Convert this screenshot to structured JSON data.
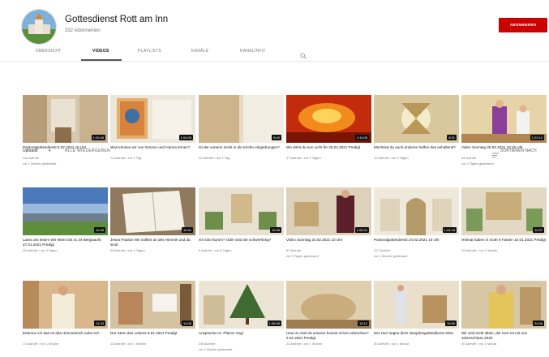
{
  "channel": {
    "name": "Gottesdienst Rott am Inn",
    "subscribers": "332 Abonnenten",
    "subscribe_label": "ABONNIEREN"
  },
  "tabs": [
    {
      "label": "ÜBERSICHT",
      "active": false
    },
    {
      "label": "VIDEOS",
      "active": true
    },
    {
      "label": "PLAYLISTS",
      "active": false
    },
    {
      "label": "KANÄLE",
      "active": false
    },
    {
      "label": "KANALINFO",
      "active": false
    }
  ],
  "toolbar": {
    "uploads_label": "Uploads",
    "play_all_label": "ALLE WIEDERGEBEN",
    "sort_label": "SORTIEREN NACH"
  },
  "videos": [
    {
      "title": "Pastoralgottesdienst 5.02.2021 15 Uhr",
      "meta1": "110 Aufrufe",
      "meta2": "vor 1 Woche gestreamt",
      "duration": "1:02:46"
    },
    {
      "title": "Was können wir von Simeon und Hanna lernen?",
      "meta1": "74 Aufrufe • vor 1 Tag",
      "meta2": "",
      "duration": "1:04:05"
    },
    {
      "title": "Ist der unreine Geist in die Kirche eingedrungen?",
      "meta1": "22 Aufrufe • vor 1 Tag",
      "meta2": "",
      "duration": "8:40"
    },
    {
      "title": "Wo steht du nun Licht für 25.01.2021 Predigt",
      "meta1": "17 Aufrufe • vor 2 Tagen",
      "meta2": "",
      "duration": "1:11:06"
    },
    {
      "title": "Möchtest du auch anderen helfen das anhaltend?",
      "meta1": "22 Aufrufe • vor 2 Tagen",
      "meta2": "",
      "duration": "8:31"
    },
    {
      "title": "Video Sonntag 25.02.2021 10:15 Uhr",
      "meta1": "44 Aufrufe",
      "meta2": "vor 4 Tagen gestreamt",
      "duration": "1:22:14"
    },
    {
      "title": "Lasst uns lesen! Wir leben bis zu 24 Bergwacht 27.01.2021 Predigt",
      "meta1": "26 Aufrufe • vor 3 Tagen",
      "meta2": "",
      "duration": "10:28"
    },
    {
      "title": "Jesus Paulus! Wir sollten an des Himmel und da sind!",
      "meta1": "29 Aufrufe • vor 4 Tagen",
      "meta2": "",
      "duration": "10:41"
    },
    {
      "title": "Ist Gott stumm? Oder sind wir schwerhörig?",
      "meta1": "9 Aufrufe • vor 5 Tagen",
      "meta2": "",
      "duration": "10:28"
    },
    {
      "title": "Video Sonntag 24.02.2021 10 Uhr",
      "meta1": "67 Aufrufe",
      "meta2": "vor 5 Tagen gestreamt",
      "duration": "1:05:22"
    },
    {
      "title": "Pastoralgottesdienst 24.02.2021 10 Uhr",
      "meta1": "227 Aufrufe",
      "meta2": "vor 1 Woche gestreamt",
      "duration": "1:04:18"
    },
    {
      "title": "Heimat haben in Gott! 8 Fasten 10.01.2021 Predigt",
      "meta1": "19 Aufrufe • vor 1 Woche",
      "meta2": "",
      "duration": "12:07"
    },
    {
      "title": "Erkenne ich das es das Himmelreich nahe ist?",
      "meta1": "17 Aufrufe • vor 1 Woche",
      "meta2": "",
      "duration": "11:33"
    },
    {
      "title": "Der Stern des Lebens 6.01.2021 Predigt",
      "meta1": "13 Aufrufe • vor 1 Woche",
      "meta2": "",
      "duration": "14:05"
    },
    {
      "title": "Ansprache Hr. Pfarrer Vogl",
      "meta1": "246 Aufrufe",
      "meta2": "vor 1 Woche gestreamt",
      "duration": "1:08:38"
    },
    {
      "title": "Heut zu Gott ist unserer kommt schon erbrechen? 2.01.2021 Predigt",
      "meta1": "23 Aufrufe • vor 1 Woche",
      "meta2": "",
      "duration": "10:12"
    },
    {
      "title": "Der Herr segne dich! Neujahrsgottesdienst 2021",
      "meta1": "30 Aufrufe • vor 1 Monat",
      "meta2": "",
      "duration": "19:50"
    },
    {
      "title": "Wir sind nicht allein, der Herr ist mit uns Jahreschluss 2020",
      "meta1": "40 Aufrufe • vor 1 Monat",
      "meta2": "",
      "duration": "24:06"
    }
  ]
}
